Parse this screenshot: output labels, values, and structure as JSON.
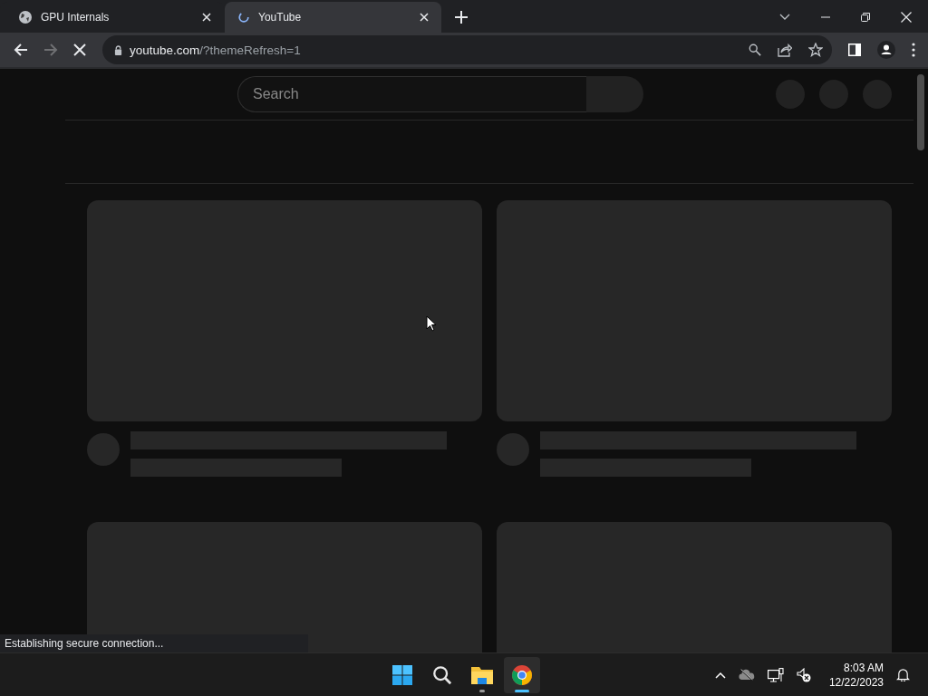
{
  "tabs": [
    {
      "title": "GPU Internals",
      "kind": "globe",
      "selected": false
    },
    {
      "title": "YouTube",
      "kind": "loading",
      "selected": true
    }
  ],
  "toolbar": {
    "back_enabled": true,
    "forward_enabled": false,
    "loading": true,
    "url_host": "youtube.com",
    "url_path": "/?themeRefresh=1",
    "bookmarked": false
  },
  "page": {
    "search": {
      "placeholder": "Search"
    },
    "video_placeholders": [
      {
        "kind": "skeleton"
      },
      {
        "kind": "skeleton"
      },
      {
        "kind": "thumbnail_only"
      },
      {
        "kind": "thumbnail_only"
      }
    ]
  },
  "status_bubble": "Establishing secure connection...",
  "taskbar": {
    "apps": [
      {
        "kind": "start",
        "running": false,
        "selected": false
      },
      {
        "kind": "search",
        "running": false,
        "selected": false
      },
      {
        "kind": "explorer",
        "running": true,
        "selected": false
      },
      {
        "kind": "chrome",
        "running": true,
        "selected": true
      }
    ],
    "time": "8:03 AM",
    "date": "12/22/2023"
  }
}
